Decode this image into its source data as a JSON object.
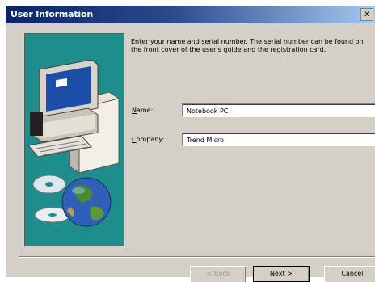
{
  "window": {
    "title": "User Information",
    "close_glyph": "x"
  },
  "instructions": "Enter your name and serial number. The serial number can be found on the front cover of the user's guide and the registration card.",
  "fields": {
    "name": {
      "label_underlined": "N",
      "label_rest": "ame:",
      "value": "Notebook PC"
    },
    "company": {
      "label_underlined": "C",
      "label_rest": "ompany:",
      "value": "Trend Micro"
    }
  },
  "buttons": {
    "back": "< Back",
    "next": "Next >",
    "cancel": "Cancel"
  },
  "colors": {
    "illustration_bg": "#1f8d8c",
    "titlebar_start": "#0a246a",
    "titlebar_end": "#a6caf0",
    "dialog_bg": "#d4d0c8"
  },
  "icons": [
    "computer-icon",
    "cd-disc-icon",
    "globe-icon"
  ]
}
